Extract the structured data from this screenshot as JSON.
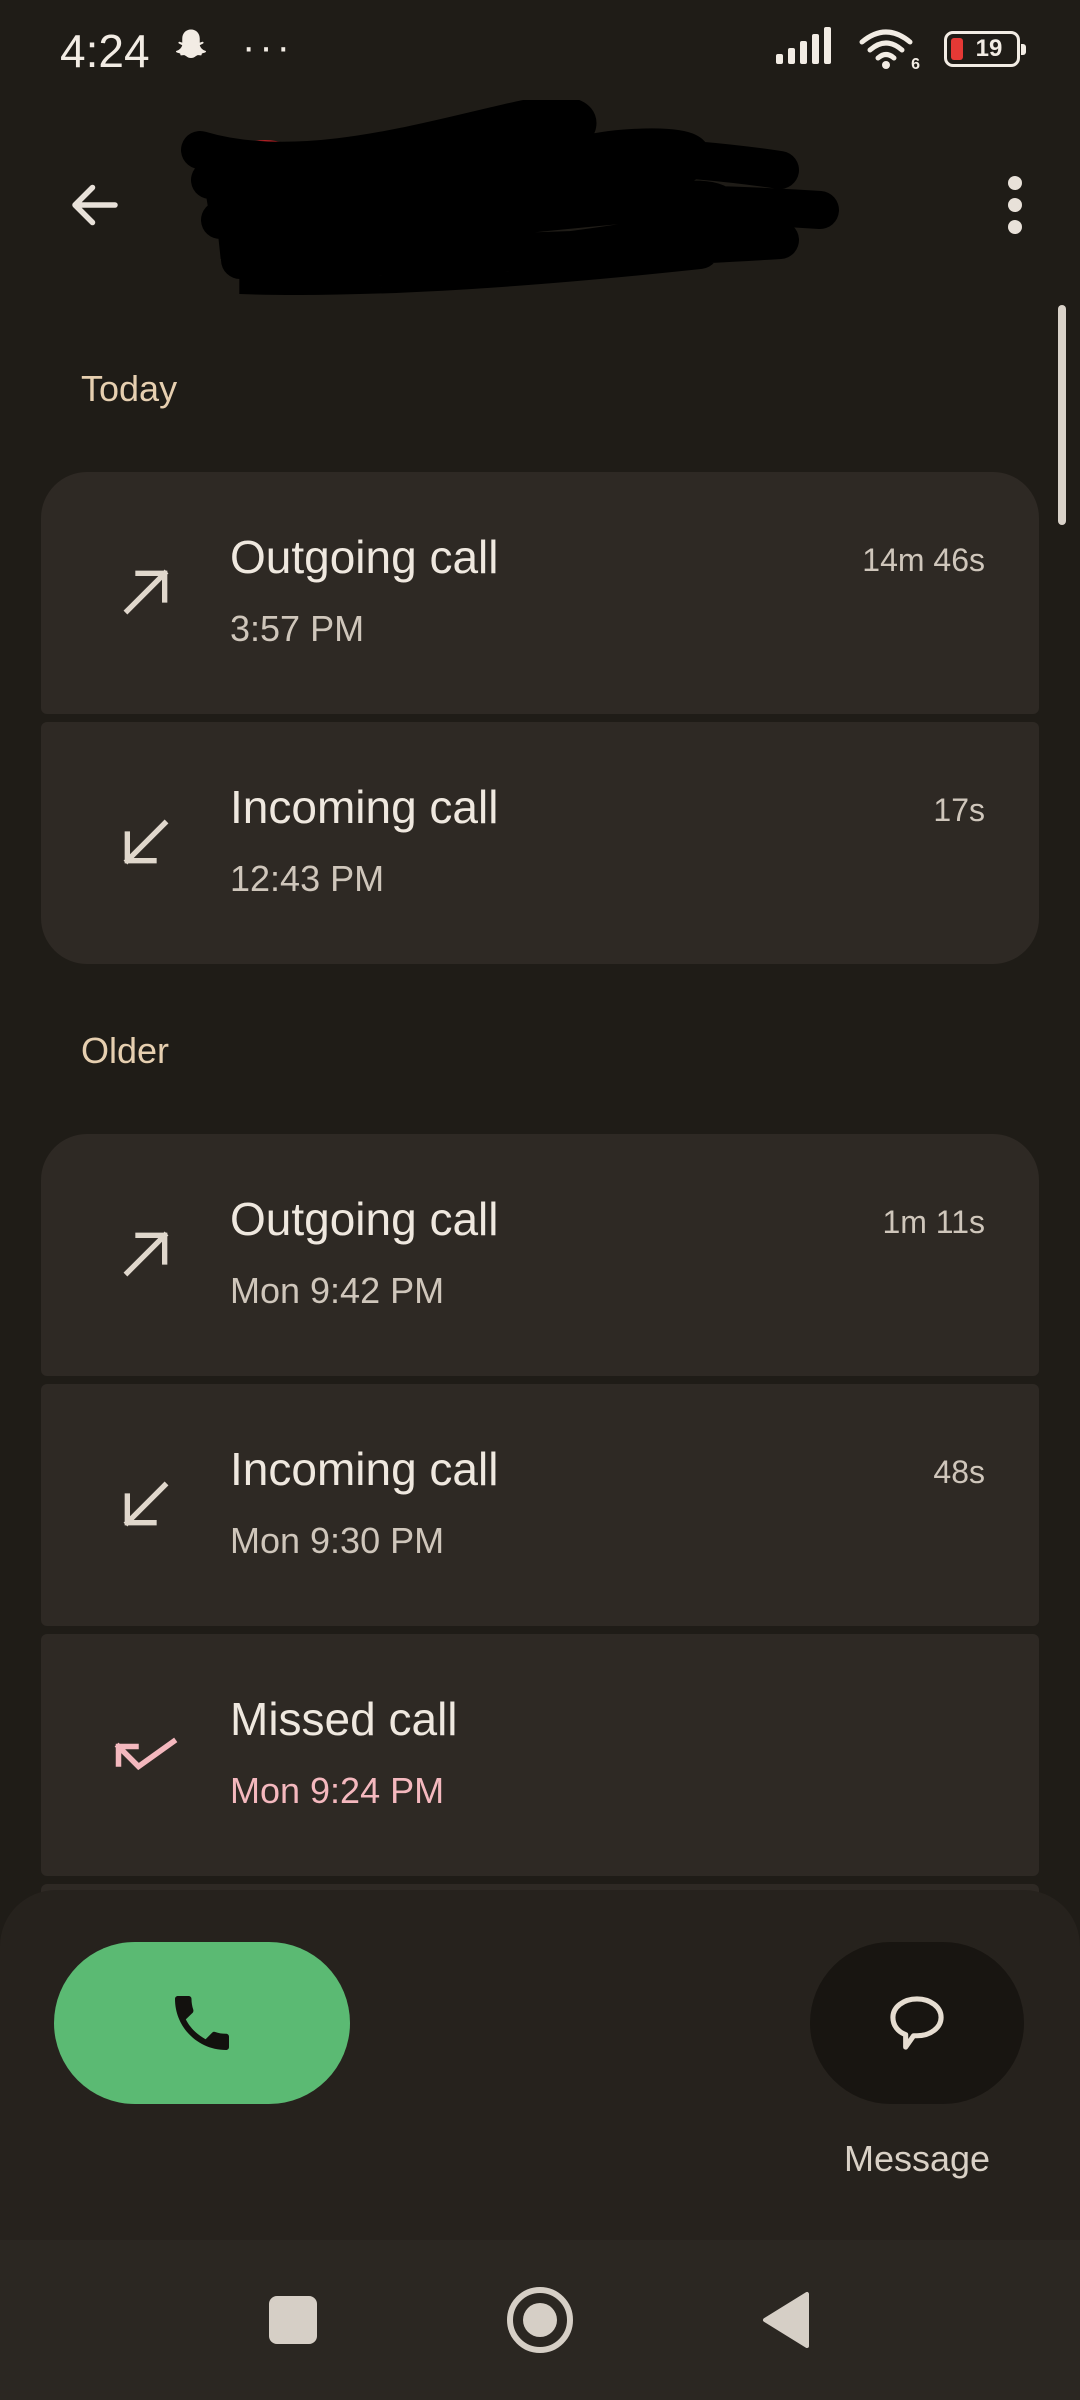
{
  "status_bar": {
    "time": "4:24",
    "overflow": "···",
    "battery_level": "19",
    "wifi_badge": "6",
    "icons": [
      "snapchat-icon",
      "signal-icon",
      "wifi-icon",
      "battery-icon"
    ]
  },
  "header": {
    "back_icon": "arrow-back-icon",
    "more_icon": "more-vert-icon"
  },
  "sections": {
    "today_label": "Today",
    "older_label": "Older"
  },
  "calls": [
    {
      "type": "Outgoing call",
      "time": "3:57 PM",
      "duration": "14m 46s",
      "icon": "outgoing-call-icon"
    },
    {
      "type": "Incoming call",
      "time": "12:43 PM",
      "duration": "17s",
      "icon": "incoming-call-icon"
    },
    {
      "type": "Outgoing call",
      "time": "Mon 9:42 PM",
      "duration": "1m 11s",
      "icon": "outgoing-call-icon"
    },
    {
      "type": "Incoming call",
      "time": "Mon 9:30 PM",
      "duration": "48s",
      "icon": "incoming-call-icon"
    },
    {
      "type": "Missed call",
      "time": "Mon 9:24 PM",
      "duration": "",
      "icon": "missed-call-icon"
    }
  ],
  "actions": {
    "call_icon": "phone-icon",
    "message_label": "Message",
    "message_icon": "chat-bubble-icon"
  },
  "colors": {
    "background": "#1f1c17",
    "card": "#2e2924",
    "call_button": "#5bba73",
    "missed": "#f4b8be",
    "accent_label": "#e6cfb0"
  },
  "nav": {
    "icons": [
      "recents-square-icon",
      "home-circle-icon",
      "back-triangle-icon"
    ]
  }
}
